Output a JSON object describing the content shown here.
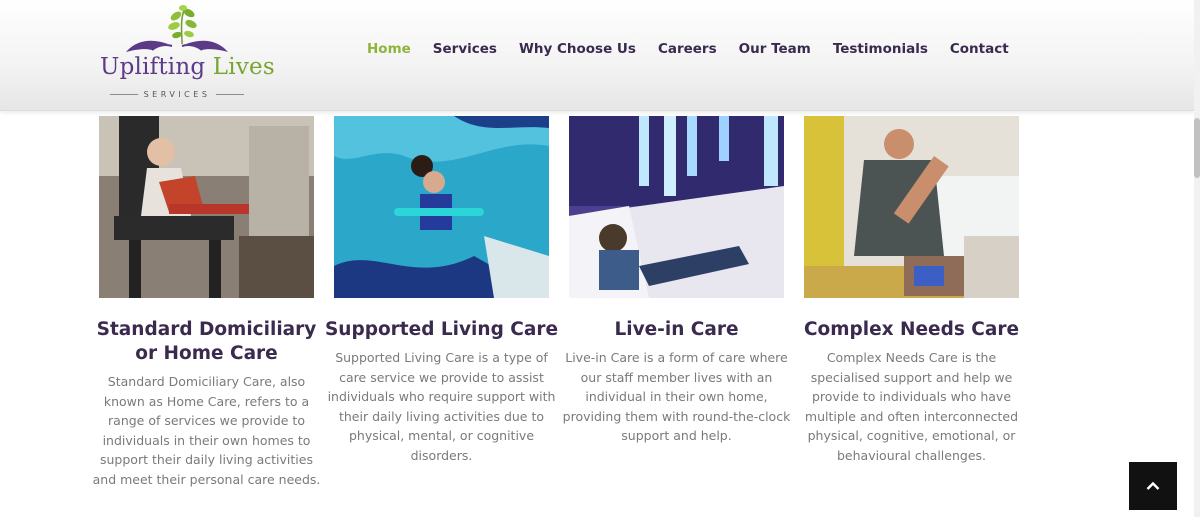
{
  "brand": {
    "name_first": "Uplifting",
    "name_second": " Lives",
    "subtitle": "SERVICES",
    "colors": {
      "purple": "#5c3a86",
      "green": "#79a432",
      "nav_active": "#8fb43a",
      "nav_text": "#3a2b4e"
    }
  },
  "nav": {
    "items": [
      {
        "label": "Home",
        "active": true
      },
      {
        "label": "Services"
      },
      {
        "label": "Why Choose Us"
      },
      {
        "label": "Careers"
      },
      {
        "label": "Our Team"
      },
      {
        "label": "Testimonials"
      },
      {
        "label": "Contact"
      }
    ]
  },
  "services": [
    {
      "title": "Standard Domiciliary or Home Care",
      "description": "Standard Domiciliary Care, also known as Home Care, refers to a range of services we provide to individuals in their own homes to support their daily living activities and meet their personal care needs."
    },
    {
      "title": "Supported Living Care",
      "description": "Supported Living Care is a type of care service we provide to assist individuals who require support with their daily living activities due to physical, mental, or cognitive disorders."
    },
    {
      "title": "Live-in Care",
      "description": "Live-in Care is a form of care where our staff member lives with an individual in their own home, providing them with round-the-clock support and help."
    },
    {
      "title": "Complex Needs Care",
      "description": "Complex Needs Care is the specialised support and help we provide to individuals who have multiple and often interconnected physical, cognitive, emotional, or behavioural challenges."
    }
  ],
  "back_to_top": {
    "icon": "chevron-up-icon"
  }
}
